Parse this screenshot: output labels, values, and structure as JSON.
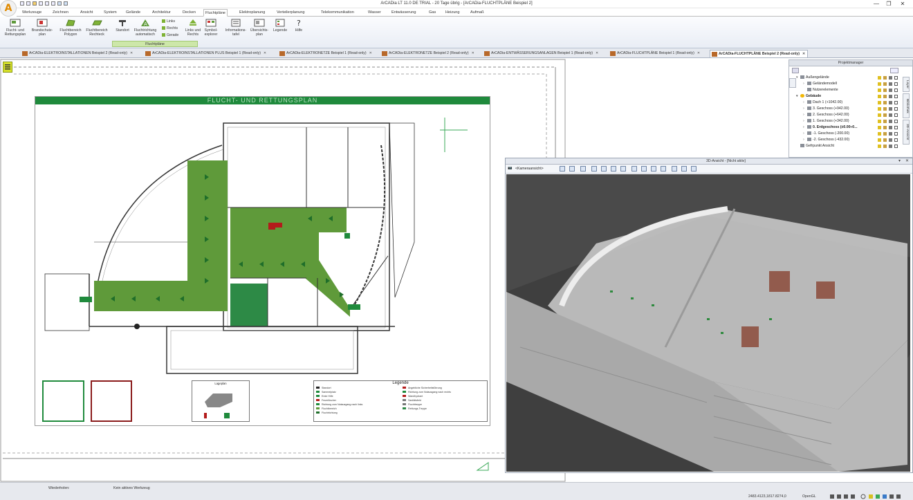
{
  "window": {
    "title": "ArCADia LT 11.0 DE TRIAL - 20 Tage übrig - [ArCADia-FLUCHTPLÄNE Beispiel 2]",
    "minimize": "—",
    "maximize": "❐",
    "close": "✕"
  },
  "menu": {
    "items": [
      "Werkzeuge",
      "Zeichnen",
      "Ansicht",
      "System",
      "Gelände",
      "Architektur",
      "Decken",
      "Fluchtpläne",
      "Elektroplanung",
      "Verteilerplanung",
      "Telekommunikation",
      "Wasser",
      "Entwässerung",
      "Gas",
      "Heizung",
      "Aufmaß"
    ],
    "active": "Fluchtpläne"
  },
  "ribbon": {
    "buttons": [
      {
        "label": "Flucht- und Rettungsplan"
      },
      {
        "label": "Brandschutz-plan"
      },
      {
        "label": "Fluchtbereich Polygon"
      },
      {
        "label": "Fluchtbereich Rechteck"
      },
      {
        "label": "Standort"
      },
      {
        "label": "Fluchtrichtung automatisch"
      },
      {
        "label": "Links und Rechts"
      },
      {
        "label": "Symbol-explorer"
      },
      {
        "label": "Informations-tafel"
      },
      {
        "label": "Übersichts-plan"
      },
      {
        "label": "Legende"
      },
      {
        "label": "Hilfe"
      }
    ],
    "direction_options": [
      "Links",
      "Rechts",
      "Gerade"
    ],
    "group_label": "Fluchtpläne"
  },
  "doc_tabs": {
    "items": [
      "ArCADia-ELEKTROINSTALLATIONEN Beispiel 2 (Read-only)",
      "ArCADia-ELEKTROINSTALLATIONEN PLUS Beispiel 1 (Read-only)",
      "ArCADia-ELEKTRONETZE Beispiel 1 (Read-only)",
      "ArCADia-ELEKTRONETZE Beispiel 2 (Read-only)",
      "ArCADia-ENTWÄSSERUNGSANLAGEN Beispiel 1 (Read-only)",
      "ArCADia-FLUCHTPLÄNE Beispiel 1 (Read-only)",
      "ArCADia-FLUCHTPLÄNE Beispiel 2 (Read-only)"
    ],
    "active_index": 6,
    "close_glyph": "✕"
  },
  "drawing": {
    "title": "FLUCHT- UND RETTUNGSPLAN",
    "legend_title": "Legende",
    "lageplan_title": "Lageplan",
    "legend_items_left": [
      "Standort",
      "Sammelplatz",
      "Erste Hilfe",
      "Feuerlöscher",
      "Richtung zum Notausgang nach links",
      "Fluchtbereich",
      "Fluchtrichtung"
    ],
    "legend_items_right": [
      "Angebliche Sicherheitsführung",
      "Richtung zum Notausgang nach rechts",
      "Wandhydrant",
      "Sanitätsfeld",
      "Fluchttreppe",
      "Rettungs-Treppe"
    ]
  },
  "project_manager": {
    "title": "Projektmanager",
    "side_tabs": [
      "Layer",
      "Bibliothek",
      "3D-Ansicht"
    ],
    "tree": [
      {
        "label": "Außengelände",
        "level": 0,
        "expander": "▾",
        "icon": "terrain-icon"
      },
      {
        "label": "Geländemodell",
        "level": 1,
        "expander": "›",
        "icon": "terrain-model-icon"
      },
      {
        "label": "Nutzerelemente",
        "level": 1,
        "expander": "",
        "icon": "user-elements-icon"
      },
      {
        "label": "Gebäude",
        "level": 0,
        "expander": "▾",
        "icon": "building-icon",
        "bold": true
      },
      {
        "label": "Dach 1 (+1042.00)",
        "level": 1,
        "expander": "›",
        "icon": "roof-icon"
      },
      {
        "label": "3. Geschoss (+942.00)",
        "level": 1,
        "expander": "›",
        "icon": "storey-icon"
      },
      {
        "label": "2. Geschoss (+642.00)",
        "level": 1,
        "expander": "›",
        "icon": "storey-icon"
      },
      {
        "label": "1. Geschoss (+342.00)",
        "level": 1,
        "expander": "›",
        "icon": "storey-icon"
      },
      {
        "label": "0. Erdgeschoss (±0.00÷0...",
        "level": 1,
        "expander": "›",
        "icon": "storey-icon",
        "bold": true
      },
      {
        "label": "-1. Geschoss (-200.00)",
        "level": 1,
        "expander": "›",
        "icon": "storey-icon"
      },
      {
        "label": "-2. Geschoss (-432.00)",
        "level": 1,
        "expander": "›",
        "icon": "storey-icon"
      },
      {
        "label": "Gefrpunkt Ansicht",
        "level": 0,
        "expander": "",
        "icon": "viewpoint-icon"
      }
    ]
  },
  "view3d": {
    "title": "3D-Ansicht - [Nicht aktiv]",
    "camera_label": "<Kameraansicht>"
  },
  "status": {
    "repeat_label": "Wiederholen:",
    "tool_label": "Kein aktives Werkzeug",
    "coords": "2483.4123,1817.8274,0",
    "opengl": "OpenGL"
  },
  "colors": {
    "escape_green": "#5f9a3a",
    "header_green": "#1f8a3c",
    "ribbon_group": "#cde7a9",
    "viewport_bg": "#4a4a4a"
  }
}
